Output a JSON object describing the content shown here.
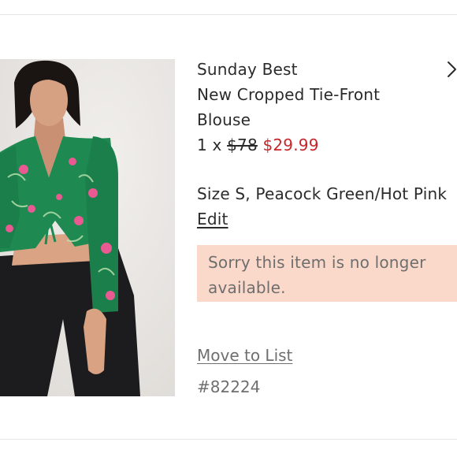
{
  "product": {
    "brand": "Sunday Best",
    "name_line1": "New Cropped Tie-Front",
    "name_line2": "Blouse",
    "quantity_prefix": "1 x",
    "original_price": "$78",
    "sale_price": "$29.99",
    "variant": "Size S, Peacock Green/Hot Pink",
    "edit_label": "Edit",
    "image_icon": "product-photo"
  },
  "alert": {
    "line1": "Sorry this item is no longer",
    "line2": "available.",
    "background": "#fbd9ca"
  },
  "actions": {
    "move_to_list_label": "Move to List",
    "next_icon": "chevron-right-icon"
  },
  "sku": "#82224",
  "colors": {
    "sale_price": "#c4262a",
    "muted_text": "#6f6f6f",
    "blouse_green": "#1e8a52"
  }
}
